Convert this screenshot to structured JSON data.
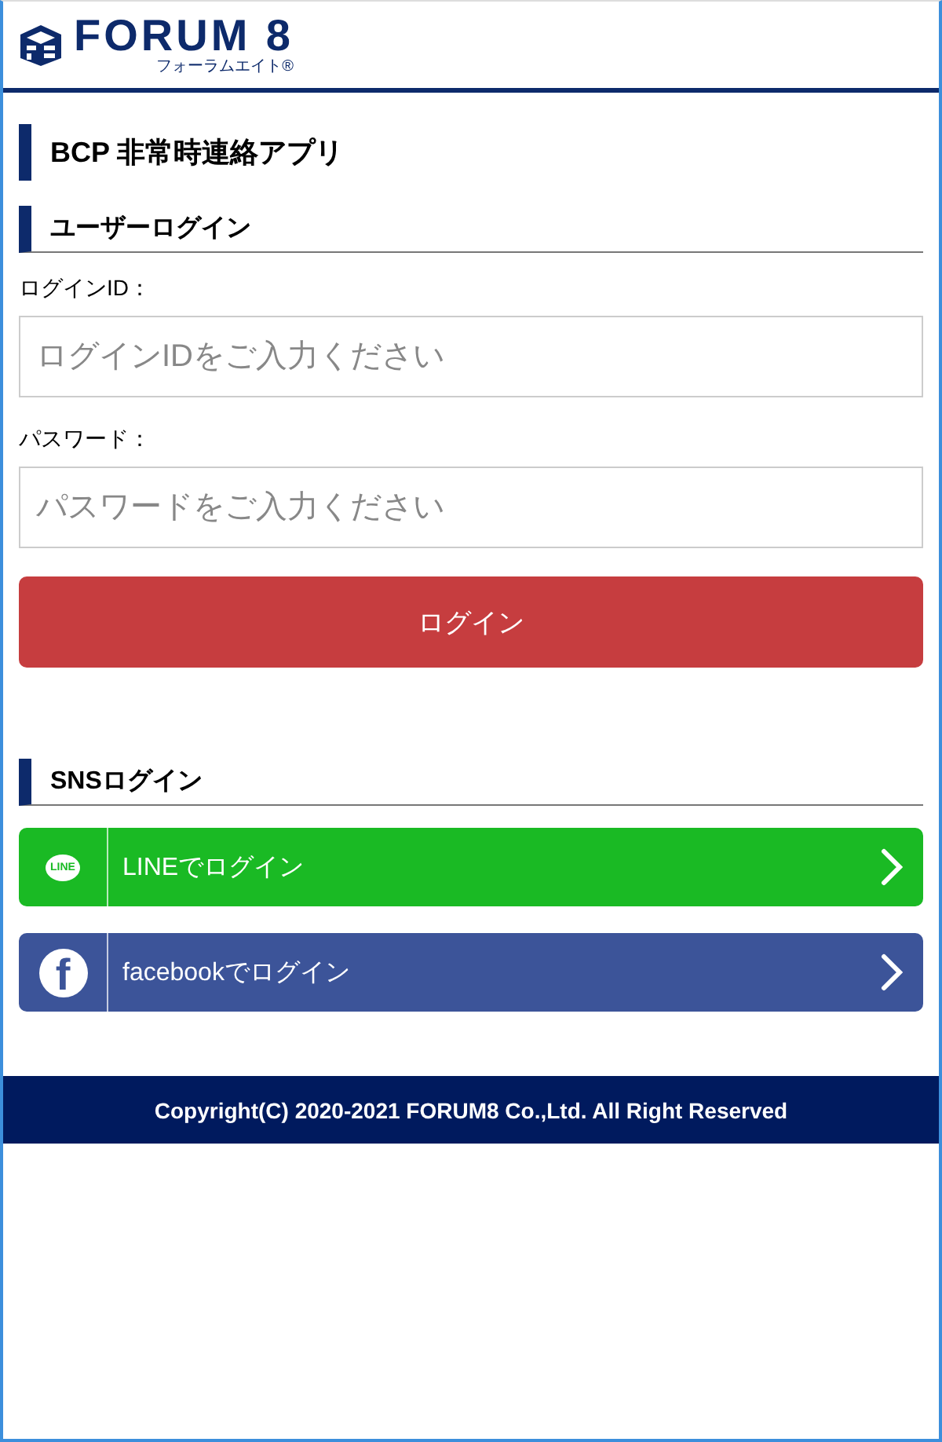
{
  "header": {
    "brand": "FORUM 8",
    "brand_sub": "フォーラムエイト®"
  },
  "app_title": "BCP 非常時連絡アプリ",
  "login_section": {
    "heading": "ユーザーログイン",
    "fields": [
      {
        "label": "ログインID：",
        "placeholder": "ログインIDをご入力ください"
      },
      {
        "label": "パスワード：",
        "placeholder": "パスワードをご入力ください"
      }
    ],
    "button": "ログイン"
  },
  "sns_section": {
    "heading": "SNSログイン",
    "buttons": [
      {
        "kind": "line",
        "icon_text": "LINE",
        "label": "LINEでログイン",
        "color": "#1aba24"
      },
      {
        "kind": "facebook",
        "icon_text": "f",
        "label": "facebookでログイン",
        "color": "#3c5499"
      }
    ]
  },
  "footer": "Copyright(C) 2020-2021 FORUM8 Co.,Ltd. All Right Reserved"
}
